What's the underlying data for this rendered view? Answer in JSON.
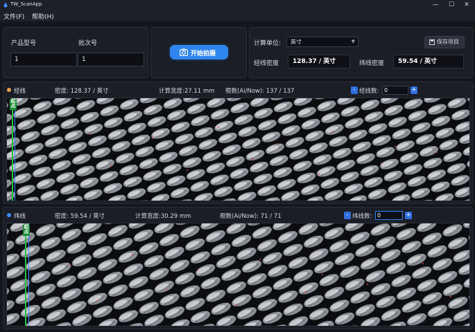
{
  "window": {
    "title": "TW_ScanApp",
    "minimize_glyph": "—",
    "maximize_glyph": "☐",
    "close_glyph": "✕"
  },
  "menu": {
    "file": "文件(F)",
    "help": "帮助(H)"
  },
  "product": {
    "model_label": "产品型号",
    "model_value": "1",
    "batch_label": "批次号",
    "batch_value": "1"
  },
  "capture": {
    "label": "开始拍摄",
    "icon": "camera-icon"
  },
  "settings": {
    "unit_label": "计算单位:",
    "unit_value": "英寸",
    "unit_arrow": "▼",
    "warp_density_label": "经线密度",
    "warp_density_value": "128.37 / 英寸",
    "weft_density_label": "纬线密度",
    "weft_density_value": "59.54 / 英寸",
    "save_label": "保存项目",
    "save_icon": "save-icon"
  },
  "warp": {
    "title": "经线",
    "density": "密度: 128.37 / 英寸",
    "calc_width": "计算宽度:27.11 mm",
    "roots": "根数(Ai/Now): 137 / 137",
    "count_label": "经线数:",
    "count_value": "0",
    "minus": "-",
    "plus": "+",
    "origin_tag": "起点",
    "dot_color": "#e8a04a"
  },
  "weft": {
    "title": "纬线",
    "density": "密度: 59.54 / 英寸",
    "calc_width": "计算宽度:30.29 mm",
    "roots": "根数(Ai/Now): 71 / 71",
    "count_label": "纬线数:",
    "count_value": "0",
    "minus": "-",
    "plus": "+",
    "origin_tag": "起点",
    "dot_color": "#3a8cff"
  },
  "colors": {
    "accent": "#2f86f0",
    "origin_green": "#26c14a",
    "bg": "#14161c"
  }
}
